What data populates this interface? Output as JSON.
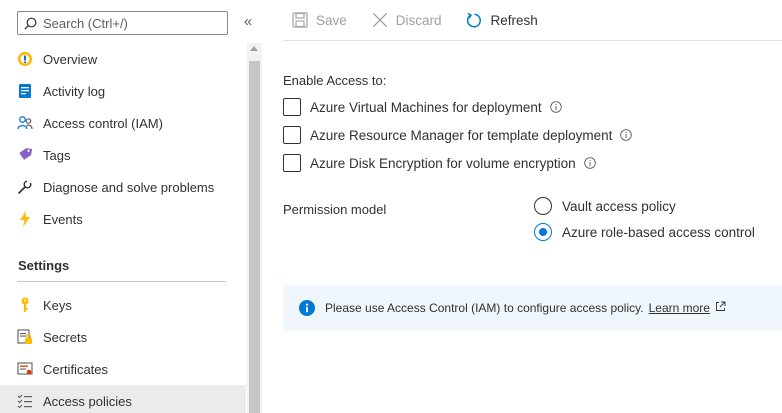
{
  "search": {
    "placeholder": "Search (Ctrl+/)"
  },
  "collapse_label": "«",
  "nav": {
    "items": [
      {
        "label": "Overview",
        "icon": "overview-icon"
      },
      {
        "label": "Activity log",
        "icon": "activity-log-icon"
      },
      {
        "label": "Access control (IAM)",
        "icon": "people-icon"
      },
      {
        "label": "Tags",
        "icon": "tag-icon"
      },
      {
        "label": "Diagnose and solve problems",
        "icon": "wrench-icon"
      },
      {
        "label": "Events",
        "icon": "lightning-icon"
      }
    ],
    "section_settings": "Settings",
    "settings_items": [
      {
        "label": "Keys",
        "icon": "key-icon"
      },
      {
        "label": "Secrets",
        "icon": "secret-icon"
      },
      {
        "label": "Certificates",
        "icon": "certificate-icon"
      },
      {
        "label": "Access policies",
        "icon": "list-icon",
        "selected": true
      }
    ]
  },
  "toolbar": {
    "save_label": "Save",
    "discard_label": "Discard",
    "refresh_label": "Refresh"
  },
  "access": {
    "title": "Enable Access to:",
    "options": [
      {
        "label": "Azure Virtual Machines for deployment",
        "checked": false
      },
      {
        "label": "Azure Resource Manager for template deployment",
        "checked": false
      },
      {
        "label": "Azure Disk Encryption for volume encryption",
        "checked": false
      }
    ]
  },
  "permission": {
    "label": "Permission model",
    "options": [
      {
        "label": "Vault access policy",
        "checked": false
      },
      {
        "label": "Azure role-based access control",
        "checked": true
      }
    ]
  },
  "info": {
    "message": "Please use Access Control (IAM) to configure access policy.",
    "link": "Learn more"
  },
  "colors": {
    "accent": "#0078d4",
    "selected_bg": "#edebe9",
    "info_bg": "#eff6fc"
  }
}
